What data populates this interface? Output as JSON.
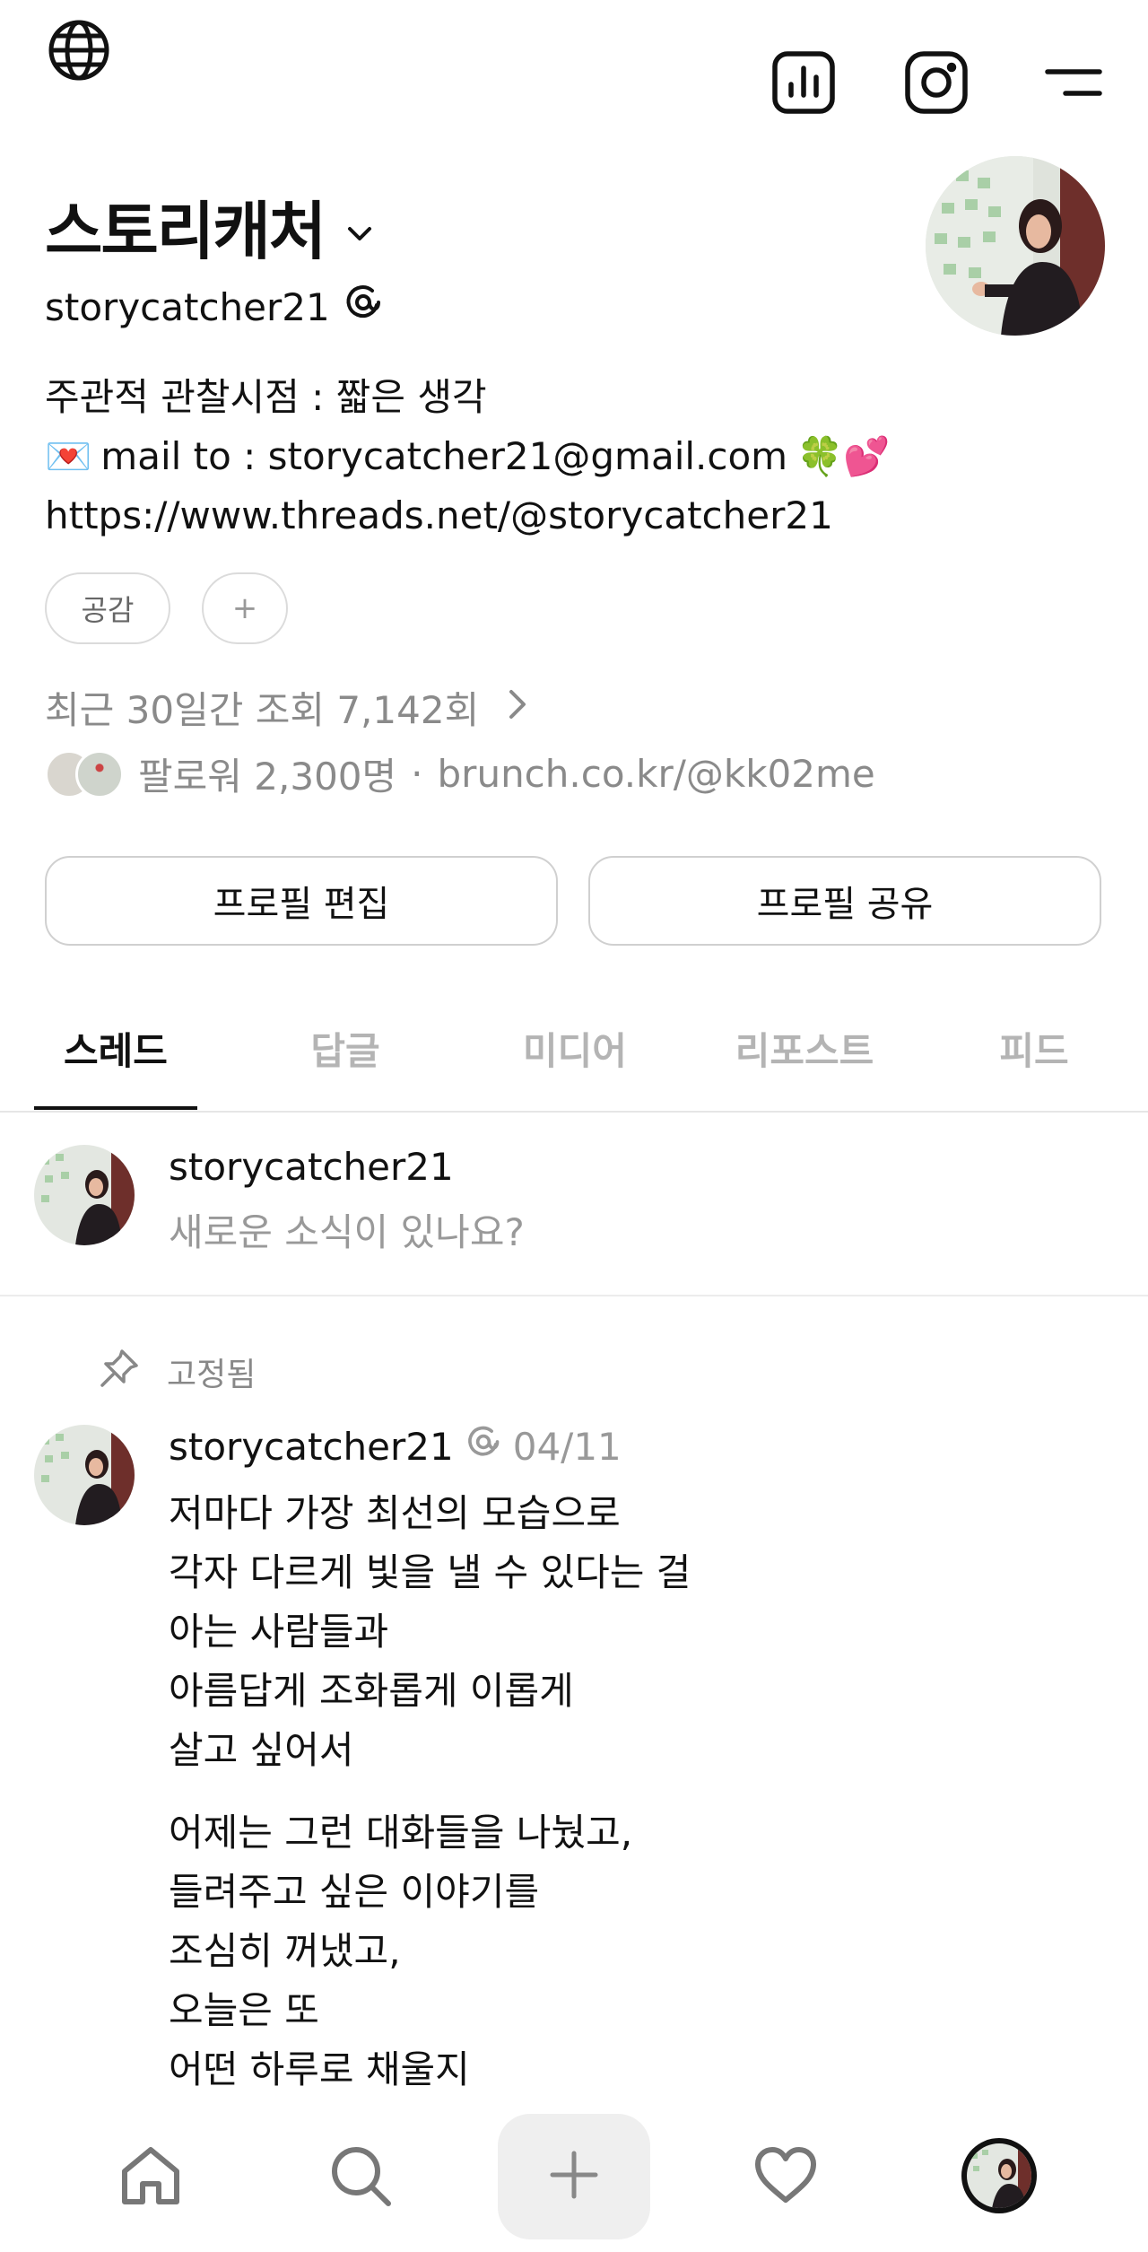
{
  "header": {
    "icons": [
      "globe-icon",
      "insights-icon",
      "instagram-icon",
      "menu-icon"
    ]
  },
  "profile": {
    "display_name": "스토리캐처",
    "username": "storycatcher21",
    "bio_line1": "주관적 관찰시점 : 짧은 생각",
    "bio_line2_prefix": "💌",
    "bio_line2": "mail to : storycatcher21@gmail.com",
    "bio_line2_suffix": "🍀💕",
    "bio_line3": "https://www.threads.net/@storycatcher21",
    "chip_empathy": "공감",
    "chip_add": "+",
    "views": "최근 30일간 조회 7,142회",
    "views_chevron": "›",
    "followers": "팔로워 2,300명",
    "separator": "·",
    "link": "brunch.co.kr/@kk02me",
    "edit_button": "프로필 편집",
    "share_button": "프로필 공유"
  },
  "tabs": [
    "스레드",
    "답글",
    "미디어",
    "리포스트",
    "피드"
  ],
  "active_tab": "스레드",
  "composer": {
    "username": "storycatcher21",
    "placeholder": "새로운 소식이 있나요?"
  },
  "post": {
    "pinned_label": "고정됨",
    "username": "storycatcher21",
    "date": "04/11",
    "paragraph1": [
      "저마다 가장 최선의 모습으로",
      "각자 다르게 빛을 낼 수 있다는 걸",
      "아는 사람들과",
      "아름답게 조화롭게 이롭게",
      "살고 싶어서"
    ],
    "paragraph2": [
      "어제는 그런 대화들을 나눴고,",
      "들려주고 싶은 이야기를",
      "조심히 꺼냈고,",
      "오늘은 또",
      "어떤 하루로 채울지"
    ]
  },
  "bottom_nav": {
    "items": [
      "home-icon",
      "search-icon",
      "plus-icon",
      "heart-icon",
      "profile-avatar"
    ],
    "plus_label": "+"
  },
  "colors": {
    "text": "#111111",
    "muted": "#8a8a8a",
    "border": "#d0d0d0",
    "tab_inactive": "#b4b4b4"
  }
}
